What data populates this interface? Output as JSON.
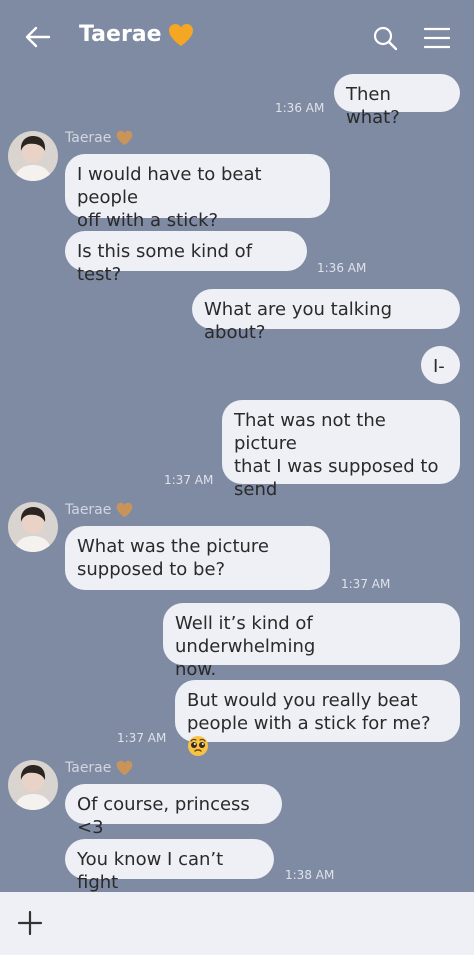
{
  "header": {
    "title": "Taerae"
  },
  "sender_name": "Taerae",
  "messages": {
    "m1": {
      "text": "Then what?",
      "time": "1:36 AM"
    },
    "m2": {
      "line1": "I would have to beat people",
      "line2": "off with a stick?"
    },
    "m3": {
      "text": "Is this some kind of test?",
      "time": "1:36 AM"
    },
    "m4": {
      "text": "What are you talking about?"
    },
    "m5": {
      "text": "I-"
    },
    "m6": {
      "line1": "That was not the picture",
      "line2": "that I was supposed to",
      "line3": "send",
      "time": "1:37 AM"
    },
    "m7": {
      "line1": "What was the picture",
      "line2": "supposed to be?",
      "time": "1:37 AM"
    },
    "m8": {
      "line1": "Well it’s kind of underwhelming",
      "line2": "now."
    },
    "m9": {
      "line1": "But would you really beat",
      "line2": "people with a stick for me?",
      "time": "1:37 AM"
    },
    "m10": {
      "text": "Of course, princess <3"
    },
    "m11": {
      "text": "You know I can’t fight",
      "time": "1:38 AM"
    }
  },
  "colors": {
    "background": "#7f8aa3",
    "bubble": "#eef0f6",
    "heart_orange": "#f5a623",
    "heart_tan": "#c9945a"
  },
  "icons": [
    "back-arrow-icon",
    "orange-heart-icon",
    "search-icon",
    "menu-icon",
    "plus-icon",
    "pleading-face-emoji"
  ]
}
